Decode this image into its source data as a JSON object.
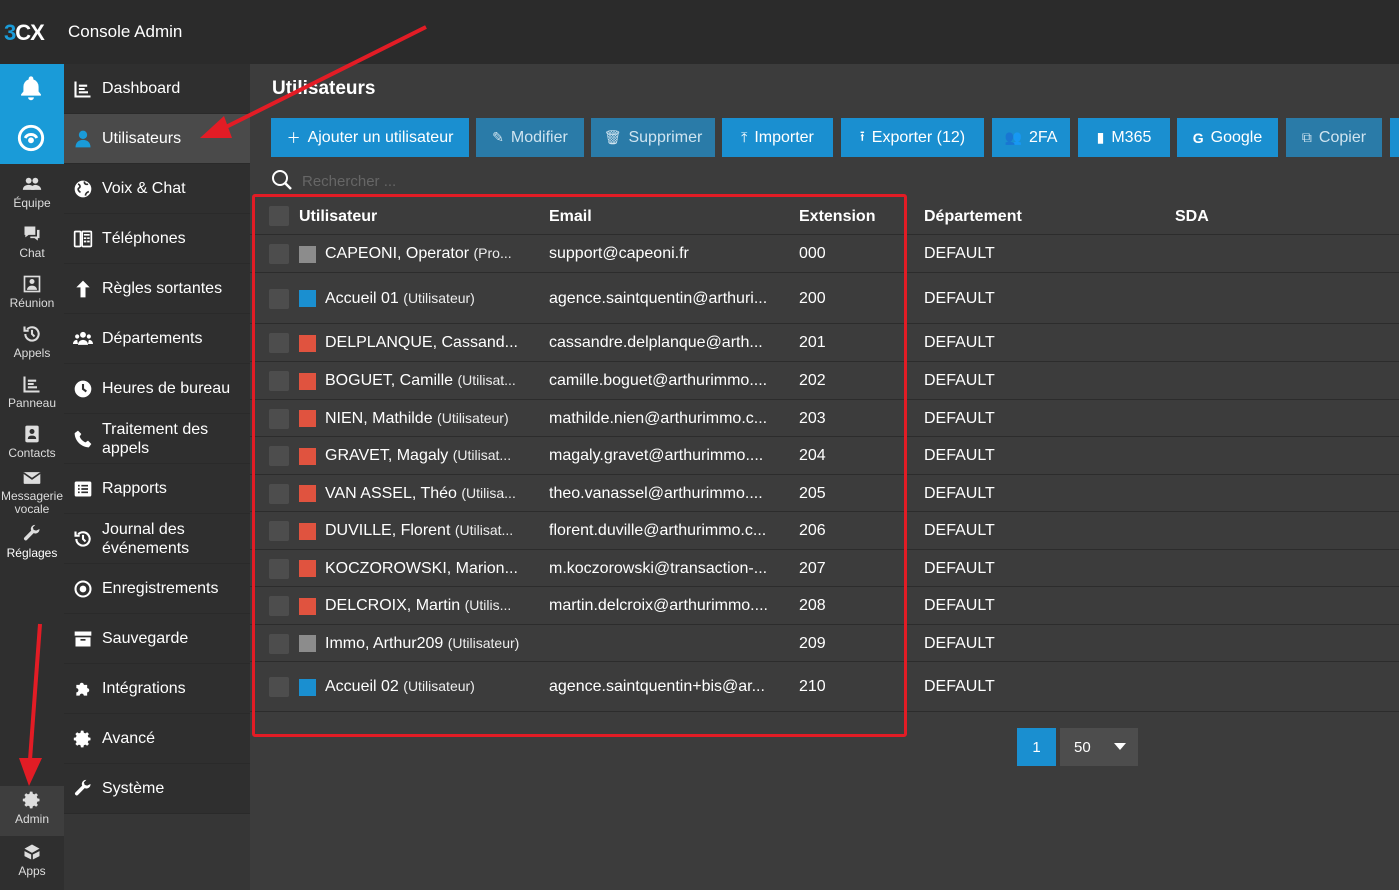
{
  "header": {
    "logo_3": "3",
    "logo_cx": "CX",
    "title": "Console Admin"
  },
  "rail": {
    "items": [
      {
        "label": "Équipe",
        "icon": "team-icon"
      },
      {
        "label": "Chat",
        "icon": "chat-icon"
      },
      {
        "label": "Réunion",
        "icon": "meeting-icon"
      },
      {
        "label": "Appels",
        "icon": "history-icon"
      },
      {
        "label": "Panneau",
        "icon": "panel-icon"
      },
      {
        "label": "Contacts",
        "icon": "contacts-icon"
      },
      {
        "label_line1": "Messagerie",
        "label_line2": "vocale",
        "icon": "voicemail-icon"
      },
      {
        "label": "Réglages",
        "icon": "wrench-icon"
      }
    ],
    "admin": {
      "label": "Admin",
      "icon": "gear-icon"
    },
    "apps": {
      "label": "Apps",
      "icon": "apps-icon"
    }
  },
  "menu": {
    "items": [
      {
        "label": "Dashboard",
        "icon": "dashboard-icon"
      },
      {
        "label": "Utilisateurs",
        "icon": "user-icon",
        "active": true
      },
      {
        "label": "Voix & Chat",
        "icon": "globe-icon"
      },
      {
        "label": "Téléphones",
        "icon": "phone-device-icon"
      },
      {
        "label": "Règles sortantes",
        "icon": "arrow-up-icon"
      },
      {
        "label": "Départements",
        "icon": "group-icon"
      },
      {
        "label": "Heures de bureau",
        "icon": "clock-icon"
      },
      {
        "label_line1": "Traitement des",
        "label_line2": "appels",
        "icon": "phone-icon"
      },
      {
        "label": "Rapports",
        "icon": "report-icon"
      },
      {
        "label_line1": "Journal des",
        "label_line2": "événements",
        "icon": "history-icon"
      },
      {
        "label": "Enregistrements",
        "icon": "record-icon"
      },
      {
        "label": "Sauvegarde",
        "icon": "archive-icon"
      },
      {
        "label": "Intégrations",
        "icon": "puzzle-icon"
      },
      {
        "label": "Avancé",
        "icon": "gear-icon"
      },
      {
        "label": "Système",
        "icon": "wrench-icon"
      }
    ]
  },
  "page": {
    "title": "Utilisateurs"
  },
  "toolbar": {
    "add": "Ajouter un utilisateur",
    "edit": "Modifier",
    "delete": "Supprimer",
    "import": "Importer",
    "export": "Exporter (12)",
    "twofa": "2FA",
    "m365": "M365",
    "google": "Google",
    "copy": "Copier"
  },
  "search": {
    "placeholder": "Rechercher ..."
  },
  "table": {
    "headers": {
      "user": "Utilisateur",
      "email": "Email",
      "extension": "Extension",
      "department": "Département",
      "sda": "SDA"
    },
    "rows": [
      {
        "name": "CAPEONI, Operator",
        "role": "(Pro...",
        "email": "support@capeoni.fr",
        "ext": "000",
        "dept": "DEFAULT",
        "color": "#8c8c8c"
      },
      {
        "name": "Accueil 01",
        "role": "(Utilisateur)",
        "email": "agence.saintquentin@arthuri...",
        "ext": "200",
        "dept": "DEFAULT",
        "color": "#1a8fd0"
      },
      {
        "name": "DELPLANQUE, Cassand...",
        "role": "",
        "email": "cassandre.delplanque@arth...",
        "ext": "201",
        "dept": "DEFAULT",
        "color": "#e0533f"
      },
      {
        "name": "BOGUET, Camille",
        "role": "(Utilisat...",
        "email": "camille.boguet@arthurimmo....",
        "ext": "202",
        "dept": "DEFAULT",
        "color": "#e0533f"
      },
      {
        "name": "NIEN, Mathilde",
        "role": "(Utilisateur)",
        "email": "mathilde.nien@arthurimmo.c...",
        "ext": "203",
        "dept": "DEFAULT",
        "color": "#e0533f"
      },
      {
        "name": "GRAVET, Magaly",
        "role": "(Utilisat...",
        "email": "magaly.gravet@arthurimmo....",
        "ext": "204",
        "dept": "DEFAULT",
        "color": "#e0533f"
      },
      {
        "name": "VAN ASSEL, Théo",
        "role": "(Utilisa...",
        "email": "theo.vanassel@arthurimmo....",
        "ext": "205",
        "dept": "DEFAULT",
        "color": "#e0533f"
      },
      {
        "name": "DUVILLE, Florent",
        "role": "(Utilisat...",
        "email": "florent.duville@arthurimmo.c...",
        "ext": "206",
        "dept": "DEFAULT",
        "color": "#e0533f"
      },
      {
        "name": "KOCZOROWSKI, Marion...",
        "role": "",
        "email": "m.koczorowski@transaction-...",
        "ext": "207",
        "dept": "DEFAULT",
        "color": "#e0533f"
      },
      {
        "name": "DELCROIX, Martin",
        "role": "(Utilis...",
        "email": "martin.delcroix@arthurimmo....",
        "ext": "208",
        "dept": "DEFAULT",
        "color": "#e0533f"
      },
      {
        "name": "Immo, Arthur209",
        "role": "(Utilisateur)",
        "email": "",
        "ext": "209",
        "dept": "DEFAULT",
        "color": "#8c8c8c"
      },
      {
        "name": "Accueil 02",
        "role": "(Utilisateur)",
        "email": "agence.saintquentin+bis@ar...",
        "ext": "210",
        "dept": "DEFAULT",
        "color": "#1a8fd0"
      }
    ]
  },
  "pagination": {
    "page": "1",
    "page_size": "50"
  },
  "colors": {
    "accent": "#1a8fd0",
    "annotation": "#e21c25"
  }
}
